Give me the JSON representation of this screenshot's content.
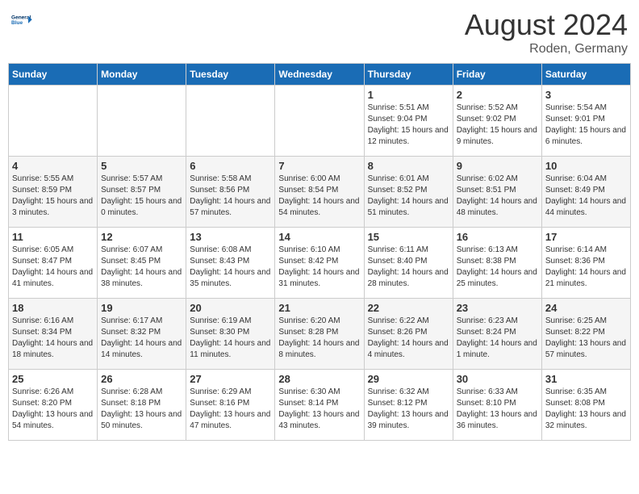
{
  "header": {
    "logo_line1": "General",
    "logo_line2": "Blue",
    "month": "August 2024",
    "location": "Roden, Germany"
  },
  "days_of_week": [
    "Sunday",
    "Monday",
    "Tuesday",
    "Wednesday",
    "Thursday",
    "Friday",
    "Saturday"
  ],
  "weeks": [
    [
      {
        "day": "",
        "info": ""
      },
      {
        "day": "",
        "info": ""
      },
      {
        "day": "",
        "info": ""
      },
      {
        "day": "",
        "info": ""
      },
      {
        "day": "1",
        "info": "Sunrise: 5:51 AM\nSunset: 9:04 PM\nDaylight: 15 hours\nand 12 minutes."
      },
      {
        "day": "2",
        "info": "Sunrise: 5:52 AM\nSunset: 9:02 PM\nDaylight: 15 hours\nand 9 minutes."
      },
      {
        "day": "3",
        "info": "Sunrise: 5:54 AM\nSunset: 9:01 PM\nDaylight: 15 hours\nand 6 minutes."
      }
    ],
    [
      {
        "day": "4",
        "info": "Sunrise: 5:55 AM\nSunset: 8:59 PM\nDaylight: 15 hours\nand 3 minutes."
      },
      {
        "day": "5",
        "info": "Sunrise: 5:57 AM\nSunset: 8:57 PM\nDaylight: 15 hours\nand 0 minutes."
      },
      {
        "day": "6",
        "info": "Sunrise: 5:58 AM\nSunset: 8:56 PM\nDaylight: 14 hours\nand 57 minutes."
      },
      {
        "day": "7",
        "info": "Sunrise: 6:00 AM\nSunset: 8:54 PM\nDaylight: 14 hours\nand 54 minutes."
      },
      {
        "day": "8",
        "info": "Sunrise: 6:01 AM\nSunset: 8:52 PM\nDaylight: 14 hours\nand 51 minutes."
      },
      {
        "day": "9",
        "info": "Sunrise: 6:02 AM\nSunset: 8:51 PM\nDaylight: 14 hours\nand 48 minutes."
      },
      {
        "day": "10",
        "info": "Sunrise: 6:04 AM\nSunset: 8:49 PM\nDaylight: 14 hours\nand 44 minutes."
      }
    ],
    [
      {
        "day": "11",
        "info": "Sunrise: 6:05 AM\nSunset: 8:47 PM\nDaylight: 14 hours\nand 41 minutes."
      },
      {
        "day": "12",
        "info": "Sunrise: 6:07 AM\nSunset: 8:45 PM\nDaylight: 14 hours\nand 38 minutes."
      },
      {
        "day": "13",
        "info": "Sunrise: 6:08 AM\nSunset: 8:43 PM\nDaylight: 14 hours\nand 35 minutes."
      },
      {
        "day": "14",
        "info": "Sunrise: 6:10 AM\nSunset: 8:42 PM\nDaylight: 14 hours\nand 31 minutes."
      },
      {
        "day": "15",
        "info": "Sunrise: 6:11 AM\nSunset: 8:40 PM\nDaylight: 14 hours\nand 28 minutes."
      },
      {
        "day": "16",
        "info": "Sunrise: 6:13 AM\nSunset: 8:38 PM\nDaylight: 14 hours\nand 25 minutes."
      },
      {
        "day": "17",
        "info": "Sunrise: 6:14 AM\nSunset: 8:36 PM\nDaylight: 14 hours\nand 21 minutes."
      }
    ],
    [
      {
        "day": "18",
        "info": "Sunrise: 6:16 AM\nSunset: 8:34 PM\nDaylight: 14 hours\nand 18 minutes."
      },
      {
        "day": "19",
        "info": "Sunrise: 6:17 AM\nSunset: 8:32 PM\nDaylight: 14 hours\nand 14 minutes."
      },
      {
        "day": "20",
        "info": "Sunrise: 6:19 AM\nSunset: 8:30 PM\nDaylight: 14 hours\nand 11 minutes."
      },
      {
        "day": "21",
        "info": "Sunrise: 6:20 AM\nSunset: 8:28 PM\nDaylight: 14 hours\nand 8 minutes."
      },
      {
        "day": "22",
        "info": "Sunrise: 6:22 AM\nSunset: 8:26 PM\nDaylight: 14 hours\nand 4 minutes."
      },
      {
        "day": "23",
        "info": "Sunrise: 6:23 AM\nSunset: 8:24 PM\nDaylight: 14 hours\nand 1 minute."
      },
      {
        "day": "24",
        "info": "Sunrise: 6:25 AM\nSunset: 8:22 PM\nDaylight: 13 hours\nand 57 minutes."
      }
    ],
    [
      {
        "day": "25",
        "info": "Sunrise: 6:26 AM\nSunset: 8:20 PM\nDaylight: 13 hours\nand 54 minutes."
      },
      {
        "day": "26",
        "info": "Sunrise: 6:28 AM\nSunset: 8:18 PM\nDaylight: 13 hours\nand 50 minutes."
      },
      {
        "day": "27",
        "info": "Sunrise: 6:29 AM\nSunset: 8:16 PM\nDaylight: 13 hours\nand 47 minutes."
      },
      {
        "day": "28",
        "info": "Sunrise: 6:30 AM\nSunset: 8:14 PM\nDaylight: 13 hours\nand 43 minutes."
      },
      {
        "day": "29",
        "info": "Sunrise: 6:32 AM\nSunset: 8:12 PM\nDaylight: 13 hours\nand 39 minutes."
      },
      {
        "day": "30",
        "info": "Sunrise: 6:33 AM\nSunset: 8:10 PM\nDaylight: 13 hours\nand 36 minutes."
      },
      {
        "day": "31",
        "info": "Sunrise: 6:35 AM\nSunset: 8:08 PM\nDaylight: 13 hours\nand 32 minutes."
      }
    ]
  ]
}
